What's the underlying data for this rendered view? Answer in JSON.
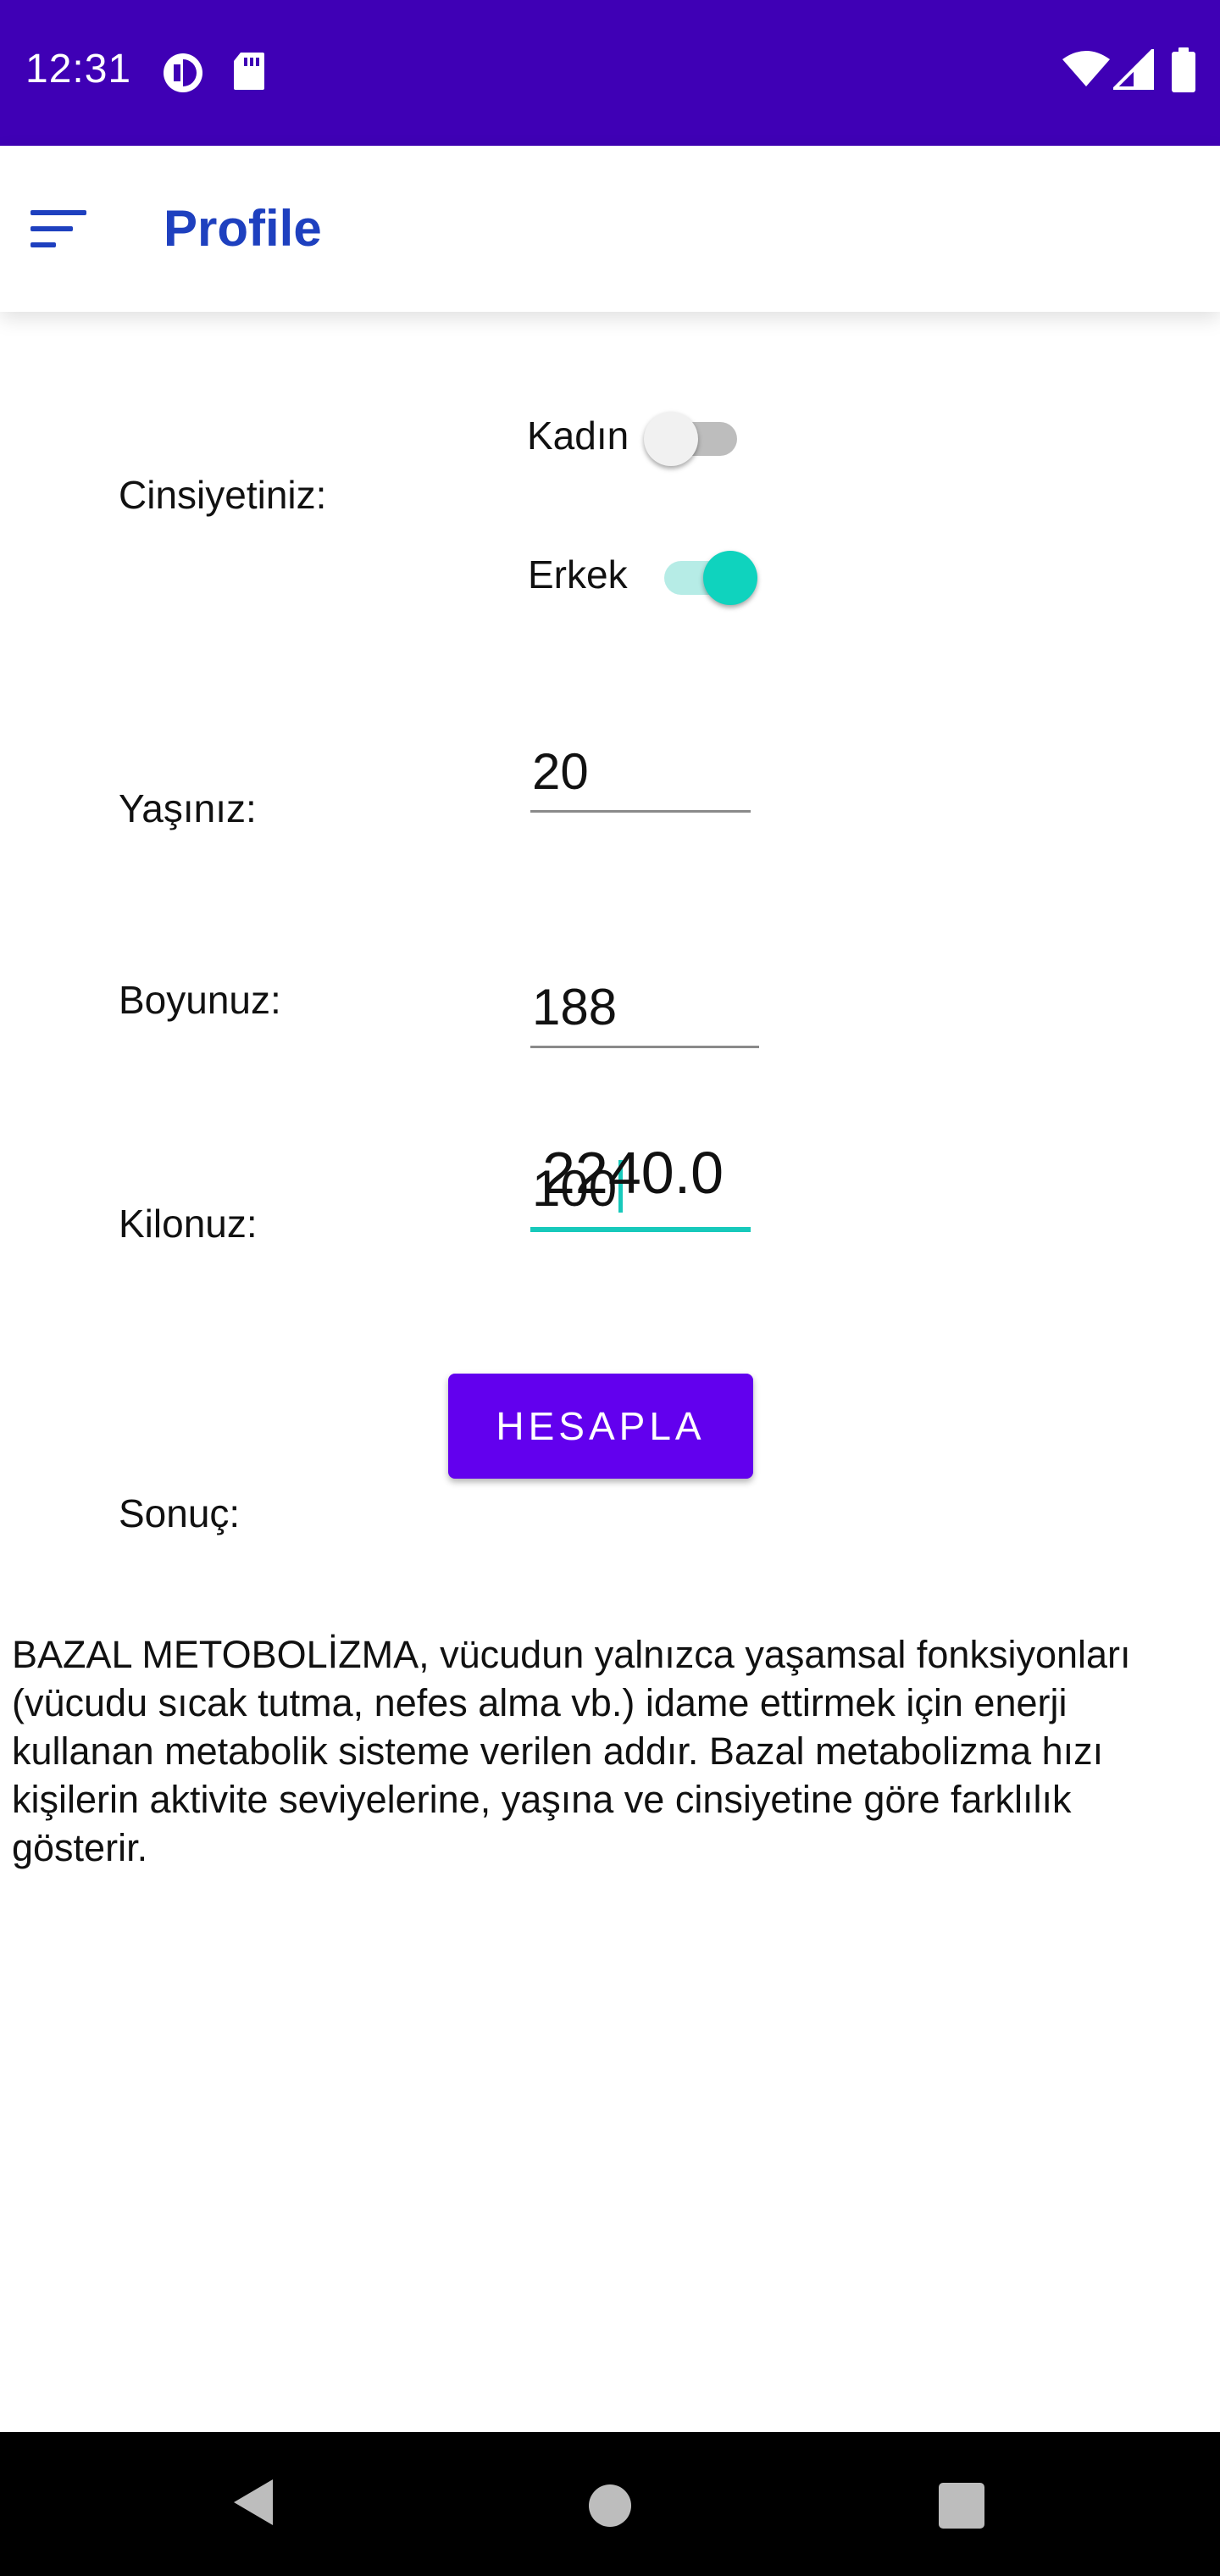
{
  "status_bar": {
    "time": "12:31",
    "left_icons": [
      "data-saver-icon",
      "sd-card-icon"
    ],
    "right_icons": [
      "wifi-icon",
      "cell-signal-icon",
      "battery-icon"
    ]
  },
  "app_bar": {
    "menu_icon": "sort-menu-icon",
    "title": "Profile"
  },
  "form": {
    "gender": {
      "label": "Cinsiyetiniz:",
      "female_label": "Kadın",
      "female_on": false,
      "male_label": "Erkek",
      "male_on": true
    },
    "age": {
      "label": "Yaşınız:",
      "value": "20"
    },
    "height": {
      "label": "Boyunuz:",
      "value": "188"
    },
    "weight": {
      "label": "Kilonuz:",
      "value": "100"
    },
    "result": {
      "label": "Sonuç:",
      "value": "2240.0"
    }
  },
  "calculate_button": {
    "label": "HESAPLA"
  },
  "info": {
    "text": "BAZAL METOBOLİZMA, vücudun yalnızca yaşamsal fonksiyonları (vücudu sıcak tutma, nefes alma vb.) idame ettirmek için enerji kullanan metabolik sisteme verilen addır. Bazal metabolizma hızı kişilerin aktivite seviyelerine, yaşına ve cinsiyetine göre farklılık gösterir."
  },
  "nav_bar": {
    "icons": [
      "back-icon",
      "home-icon",
      "recents-icon"
    ]
  },
  "colors": {
    "status_bar": "#3f00b5",
    "title": "#1e40bf",
    "accent": "#0fd3be",
    "button": "#6200ee"
  }
}
